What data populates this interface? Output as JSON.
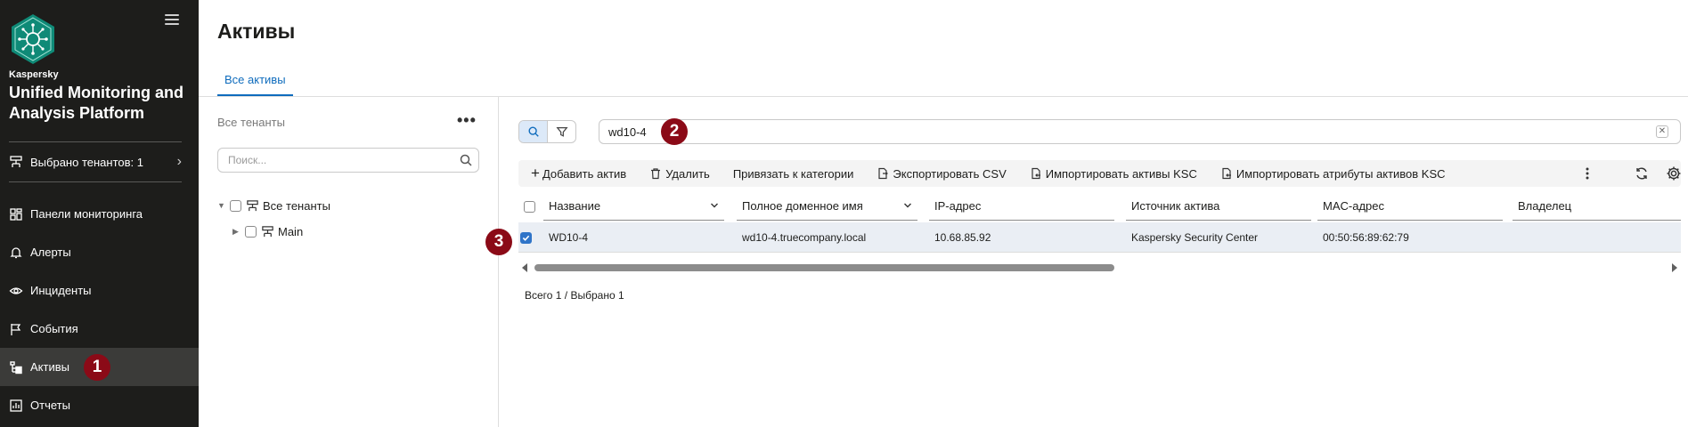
{
  "sidebar": {
    "brand": "Kaspersky",
    "product": "Unified Monitoring and Analysis Platform",
    "tenants_label": "Выбрано тенантов: 1",
    "items": [
      {
        "label": "Панели мониторинга",
        "icon": "dashboard-icon"
      },
      {
        "label": "Алерты",
        "icon": "bell-icon"
      },
      {
        "label": "Инциденты",
        "icon": "eye-icon"
      },
      {
        "label": "События",
        "icon": "flag-icon"
      },
      {
        "label": "Активы",
        "icon": "assets-icon",
        "active": true
      },
      {
        "label": "Отчеты",
        "icon": "report-icon"
      }
    ]
  },
  "header": {
    "title": "Активы",
    "tabs": [
      {
        "label": "Все активы",
        "active": true
      }
    ]
  },
  "tree": {
    "title": "Все тенанты",
    "search_placeholder": "Поиск...",
    "nodes": [
      {
        "label": "Все тенанты",
        "expanded": true
      },
      {
        "label": "Main",
        "expanded": false
      }
    ]
  },
  "search": {
    "query": "wd10-4",
    "mode": "search"
  },
  "toolbar": {
    "add": "Добавить актив",
    "delete": "Удалить",
    "bind": "Привязать к категории",
    "export": "Экспортировать CSV",
    "import_assets": "Импортировать активы KSC",
    "import_attrs": "Импортировать атрибуты активов KSC"
  },
  "table": {
    "columns": [
      "Название",
      "Полное доменное имя",
      "IP-адрес",
      "Источник актива",
      "MAC-адрес",
      "Владелец"
    ],
    "rows": [
      {
        "selected": true,
        "cells": [
          "WD10-4",
          "wd10-4.truecompany.local",
          "10.68.85.92",
          "Kaspersky Security Center",
          "00:50:56:89:62:79",
          ""
        ]
      }
    ]
  },
  "footer": {
    "total": "Всего 1 / Выбрано 1"
  },
  "badges": [
    "1",
    "2",
    "3"
  ],
  "colors": {
    "sidebar": "#1d1d1b",
    "accent": "#0f6cbd",
    "badge": "#8b0a17",
    "selected_row": "#eaeef4"
  }
}
